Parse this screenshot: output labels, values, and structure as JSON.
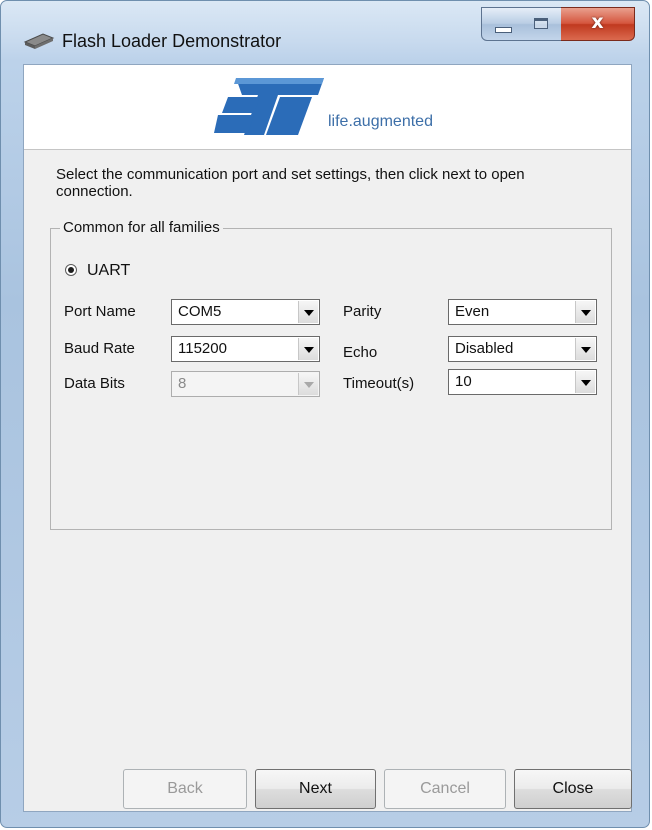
{
  "window": {
    "title": "Flash Loader Demonstrator",
    "controls": {
      "minimize": "minimize",
      "maximize": "maximize",
      "close_glyph": "x"
    }
  },
  "banner": {
    "logo": "st-logo",
    "tagline": "life.augmented"
  },
  "instruction": "Select the communication port and set settings, then click next to open connection.",
  "group": {
    "title": "Common for all families",
    "mode_radio": {
      "label": "UART",
      "selected": true
    }
  },
  "settings": {
    "port_name": {
      "label": "Port Name",
      "value": "COM5"
    },
    "baud_rate": {
      "label": "Baud Rate",
      "value": "115200"
    },
    "data_bits": {
      "label": "Data Bits",
      "value": "8",
      "enabled": false
    },
    "parity": {
      "label": "Parity",
      "value": "Even"
    },
    "echo": {
      "label": "Echo",
      "value": "Disabled"
    },
    "timeout": {
      "label": "Timeout(s)",
      "value": "10"
    }
  },
  "buttons": {
    "back": {
      "label": "Back",
      "enabled": false
    },
    "next": {
      "label": "Next",
      "enabled": true
    },
    "cancel": {
      "label": "Cancel",
      "enabled": false
    },
    "close": {
      "label": "Close",
      "enabled": true
    }
  },
  "colors": {
    "brand_blue": "#2b6cb8",
    "tagline": "#3d6fa8",
    "close_button": "#c0391f"
  }
}
